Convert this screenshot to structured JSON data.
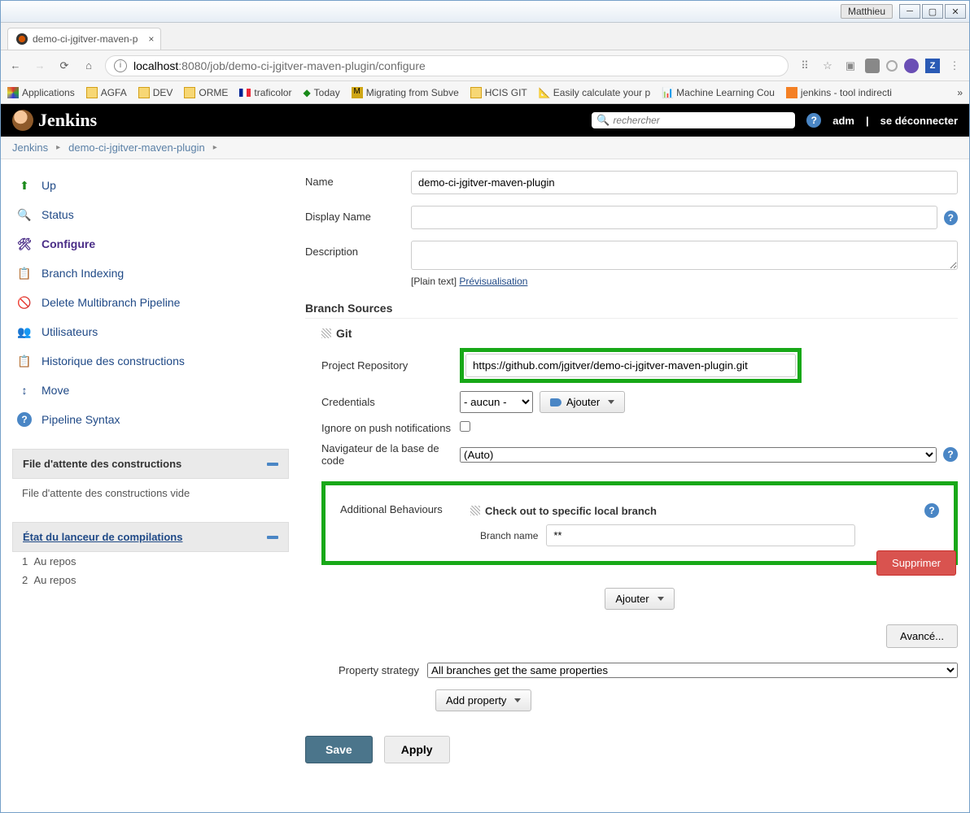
{
  "os": {
    "user": "Matthieu"
  },
  "browser": {
    "tab_title": "demo-ci-jgitver-maven-p",
    "url_host": "localhost",
    "url_port": ":8080",
    "url_path": "/job/demo-ci-jgitver-maven-plugin/configure",
    "bookmarks": [
      {
        "label": "Applications",
        "icon": "apps"
      },
      {
        "label": "AGFA",
        "icon": "folder"
      },
      {
        "label": "DEV",
        "icon": "folder"
      },
      {
        "label": "ORME",
        "icon": "folder"
      },
      {
        "label": "traficolor",
        "icon": "flag-fr"
      },
      {
        "label": "Today",
        "icon": "diamond"
      },
      {
        "label": "Migrating from Subve",
        "icon": "m"
      },
      {
        "label": "HCIS GIT",
        "icon": "folder"
      },
      {
        "label": "Easily calculate your p",
        "icon": "calc"
      },
      {
        "label": "Machine Learning Cou",
        "icon": "ml"
      },
      {
        "label": "jenkins - tool indirecti",
        "icon": "so"
      }
    ]
  },
  "header": {
    "brand": "Jenkins",
    "search_placeholder": "rechercher",
    "user": "adm",
    "logout": "se déconnecter"
  },
  "breadcrumbs": [
    "Jenkins",
    "demo-ci-jgitver-maven-plugin"
  ],
  "sidebar": {
    "items": [
      {
        "label": "Up",
        "icon": "up"
      },
      {
        "label": "Status",
        "icon": "status"
      },
      {
        "label": "Configure",
        "icon": "configure",
        "active": true
      },
      {
        "label": "Branch Indexing",
        "icon": "branch"
      },
      {
        "label": "Delete Multibranch Pipeline",
        "icon": "delete"
      },
      {
        "label": "Utilisateurs",
        "icon": "users"
      },
      {
        "label": "Historique des constructions",
        "icon": "history"
      },
      {
        "label": "Move",
        "icon": "move"
      },
      {
        "label": "Pipeline Syntax",
        "icon": "help"
      }
    ],
    "queue": {
      "title": "File d'attente des constructions",
      "body": "File d'attente des constructions vide"
    },
    "executor": {
      "title": "État du lanceur de compilations",
      "items": [
        {
          "num": "1",
          "label": "Au repos"
        },
        {
          "num": "2",
          "label": "Au repos"
        }
      ]
    }
  },
  "form": {
    "name_label": "Name",
    "name_value": "demo-ci-jgitver-maven-plugin",
    "display_label": "Display Name",
    "desc_label": "Description",
    "desc_plain": "[Plain text]",
    "desc_preview": "Prévisualisation",
    "branch_sources_title": "Branch Sources",
    "git_title": "Git",
    "repo_label": "Project Repository",
    "repo_value": "https://github.com/jgitver/demo-ci-jgitver-maven-plugin.git",
    "cred_label": "Credentials",
    "cred_value": "- aucun -",
    "add_cred_btn": "Ajouter",
    "ignore_push_label": "Ignore on push notifications",
    "nav_label": "Navigateur de la base de code",
    "nav_value": "(Auto)",
    "behaviours_title": "Additional Behaviours",
    "checkout_title": "Check out to specific local branch",
    "branch_name_label": "Branch name",
    "branch_name_value": "**",
    "delete_btn": "Supprimer",
    "add_behaviour_btn": "Ajouter",
    "advanced_btn": "Avancé...",
    "prop_strategy_label": "Property strategy",
    "prop_strategy_value": "All branches get the same properties",
    "add_property_btn": "Add property",
    "save_btn": "Save",
    "apply_btn": "Apply"
  }
}
